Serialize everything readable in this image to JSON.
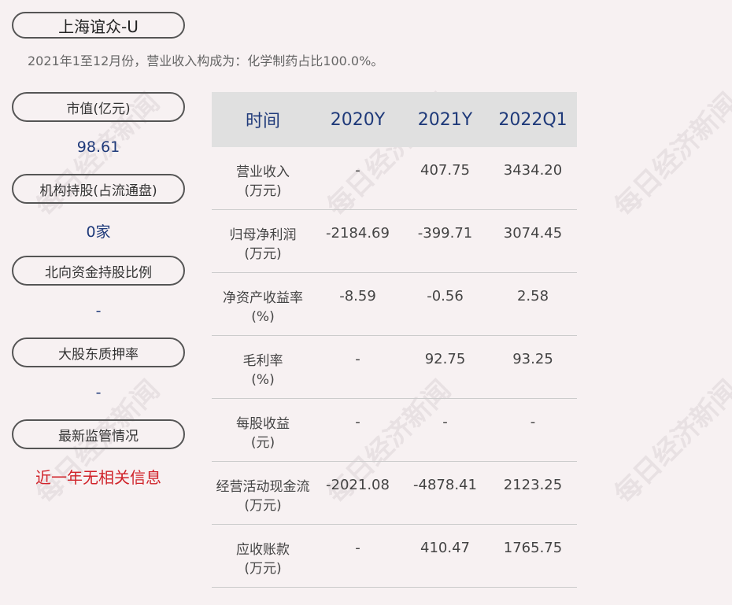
{
  "company": {
    "name": "上海谊众-U"
  },
  "summary": "2021年1至12月份，营业收入构成为：化学制药占比100.0%。",
  "left_panel": {
    "market_cap": {
      "label": "市值(亿元)",
      "value": "98.61"
    },
    "institution": {
      "label": "机构持股(占流通盘)",
      "value": "0家"
    },
    "northbound": {
      "label": "北向资金持股比例",
      "value": "-"
    },
    "pledge": {
      "label": "大股东质押率",
      "value": "-"
    },
    "regulation": {
      "label": "最新监管情况",
      "value": "近一年无相关信息"
    }
  },
  "table": {
    "headers": [
      "时间",
      "2020Y",
      "2021Y",
      "2022Q1"
    ],
    "rows": [
      {
        "name": "营业收入",
        "unit": "(万元)",
        "values": [
          "-",
          "407.75",
          "3434.20"
        ]
      },
      {
        "name": "归母净利润",
        "unit": "(万元)",
        "values": [
          "-2184.69",
          "-399.71",
          "3074.45"
        ]
      },
      {
        "name": "净资产收益率",
        "unit": "(%)",
        "values": [
          "-8.59",
          "-0.56",
          "2.58"
        ]
      },
      {
        "name": "毛利率",
        "unit": "(%)",
        "values": [
          "-",
          "92.75",
          "93.25"
        ]
      },
      {
        "name": "每股收益",
        "unit": "(元)",
        "values": [
          "-",
          "-",
          "-"
        ]
      },
      {
        "name": "经营活动现金流",
        "unit": "(万元)",
        "values": [
          "-2021.08",
          "-4878.41",
          "2123.25"
        ]
      },
      {
        "name": "应收账款",
        "unit": "(万元)",
        "values": [
          "-",
          "410.47",
          "1765.75"
        ]
      }
    ]
  },
  "watermark": "每日经济新闻",
  "colors": {
    "header_text": "#1f3a7a",
    "alert_text": "#d0232a",
    "background": "#f7f1f2"
  }
}
